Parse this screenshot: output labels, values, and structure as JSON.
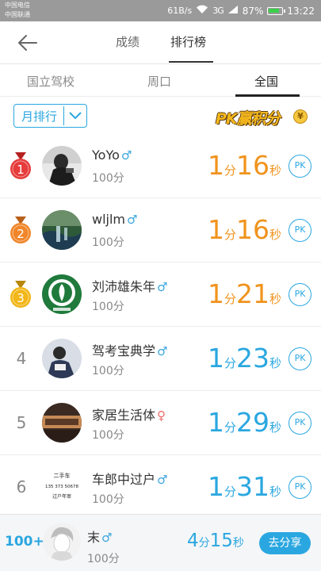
{
  "status_bar": {
    "carrier": [
      "中国电信",
      "中国联通"
    ],
    "net_speed": "61B/s",
    "signal": "3G",
    "battery": "87%",
    "time": "13:22"
  },
  "header": {
    "tabs": [
      {
        "label": "成绩"
      },
      {
        "label": "排行榜"
      }
    ]
  },
  "subtabs": [
    {
      "label": "国立驾校"
    },
    {
      "label": "周口"
    },
    {
      "label": "全国"
    }
  ],
  "filter": {
    "month_label": "月排行"
  },
  "pk_banner": {
    "text": "PK赢积分",
    "coin": "¥"
  },
  "ranking": [
    {
      "rank": "1",
      "name": "YoYo",
      "gender": "♂",
      "score": "100分",
      "time_min": "1",
      "min_unit": "分",
      "time_sec": "16",
      "sec_unit": "秒",
      "pk": "PK"
    },
    {
      "rank": "2",
      "name": "wljlm",
      "gender": "♂",
      "score": "100分",
      "time_min": "1",
      "min_unit": "分",
      "time_sec": "16",
      "sec_unit": "秒",
      "pk": "PK"
    },
    {
      "rank": "3",
      "name": "刘沛雄朱年",
      "gender": "♂",
      "score": "100分",
      "time_min": "1",
      "min_unit": "分",
      "time_sec": "21",
      "sec_unit": "秒",
      "pk": "PK"
    },
    {
      "rank": "4",
      "name": "驾考宝典学",
      "gender": "♂",
      "score": "100分",
      "time_min": "1",
      "min_unit": "分",
      "time_sec": "23",
      "sec_unit": "秒",
      "pk": "PK"
    },
    {
      "rank": "5",
      "name": "家居生活体",
      "gender": "♀",
      "score": "100分",
      "time_min": "1",
      "min_unit": "分",
      "time_sec": "29",
      "sec_unit": "秒",
      "pk": "PK"
    },
    {
      "rank": "6",
      "name": "车郎中过户",
      "gender": "♂",
      "score": "100分",
      "time_min": "1",
      "min_unit": "分",
      "time_sec": "31",
      "sec_unit": "秒",
      "pk": "PK",
      "avatar_text": [
        "二手车",
        "135 373 50678",
        "过户年审"
      ]
    }
  ],
  "me": {
    "rank": "100+",
    "name": "末",
    "gender": "♂",
    "score": "100分",
    "time_min": "4",
    "min_unit": "分",
    "time_sec": "15",
    "sec_unit": "秒",
    "share_label": "去分享"
  },
  "colors": {
    "accent": "#2aa7e0",
    "gold_time": "#f0931d",
    "medal_gold": "#f2b619",
    "medal_silver_orange": "#f0862a",
    "medal_red": "#e63c3c"
  }
}
